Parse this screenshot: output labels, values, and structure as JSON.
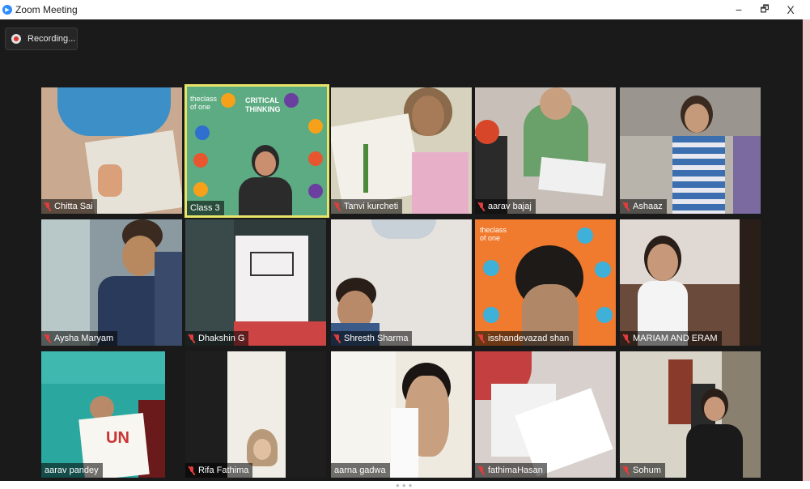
{
  "window": {
    "title": "Zoom Meeting",
    "minimize_glyph": "−",
    "maximize_glyph": "🗗",
    "close_glyph": "X"
  },
  "recording": {
    "label": "Recording..."
  },
  "participants": [
    {
      "name": "Chitta Sai",
      "muted": true
    },
    {
      "name": "Class 3",
      "muted": false,
      "active_speaker": true
    },
    {
      "name": "Tanvi kurcheti",
      "muted": true
    },
    {
      "name": "aarav bajaj",
      "muted": true
    },
    {
      "name": "Ashaaz",
      "muted": true
    },
    {
      "name": "Aysha Maryam",
      "muted": true
    },
    {
      "name": "Dhakshin G",
      "muted": true
    },
    {
      "name": "Shresth Sharma",
      "muted": true
    },
    {
      "name": "isshandevazad shan",
      "muted": true
    },
    {
      "name": "MARIAM AND ERAM",
      "muted": true
    },
    {
      "name": "aarav pandey",
      "muted": false
    },
    {
      "name": "Rifa Fathima",
      "muted": true
    },
    {
      "name": "aarna gadwa",
      "muted": false
    },
    {
      "name": "fathimaHasan",
      "muted": true
    },
    {
      "name": "Sohum",
      "muted": true
    }
  ],
  "slides": {
    "class3_brand": "theclass of one",
    "class3_heading": "CRITICAL THINKING",
    "shan_brand": "theclass of one"
  },
  "colors": {
    "active_border": "#e8e46a",
    "muted_icon": "#e23c3c",
    "zoom_blue": "#2d8cff"
  }
}
